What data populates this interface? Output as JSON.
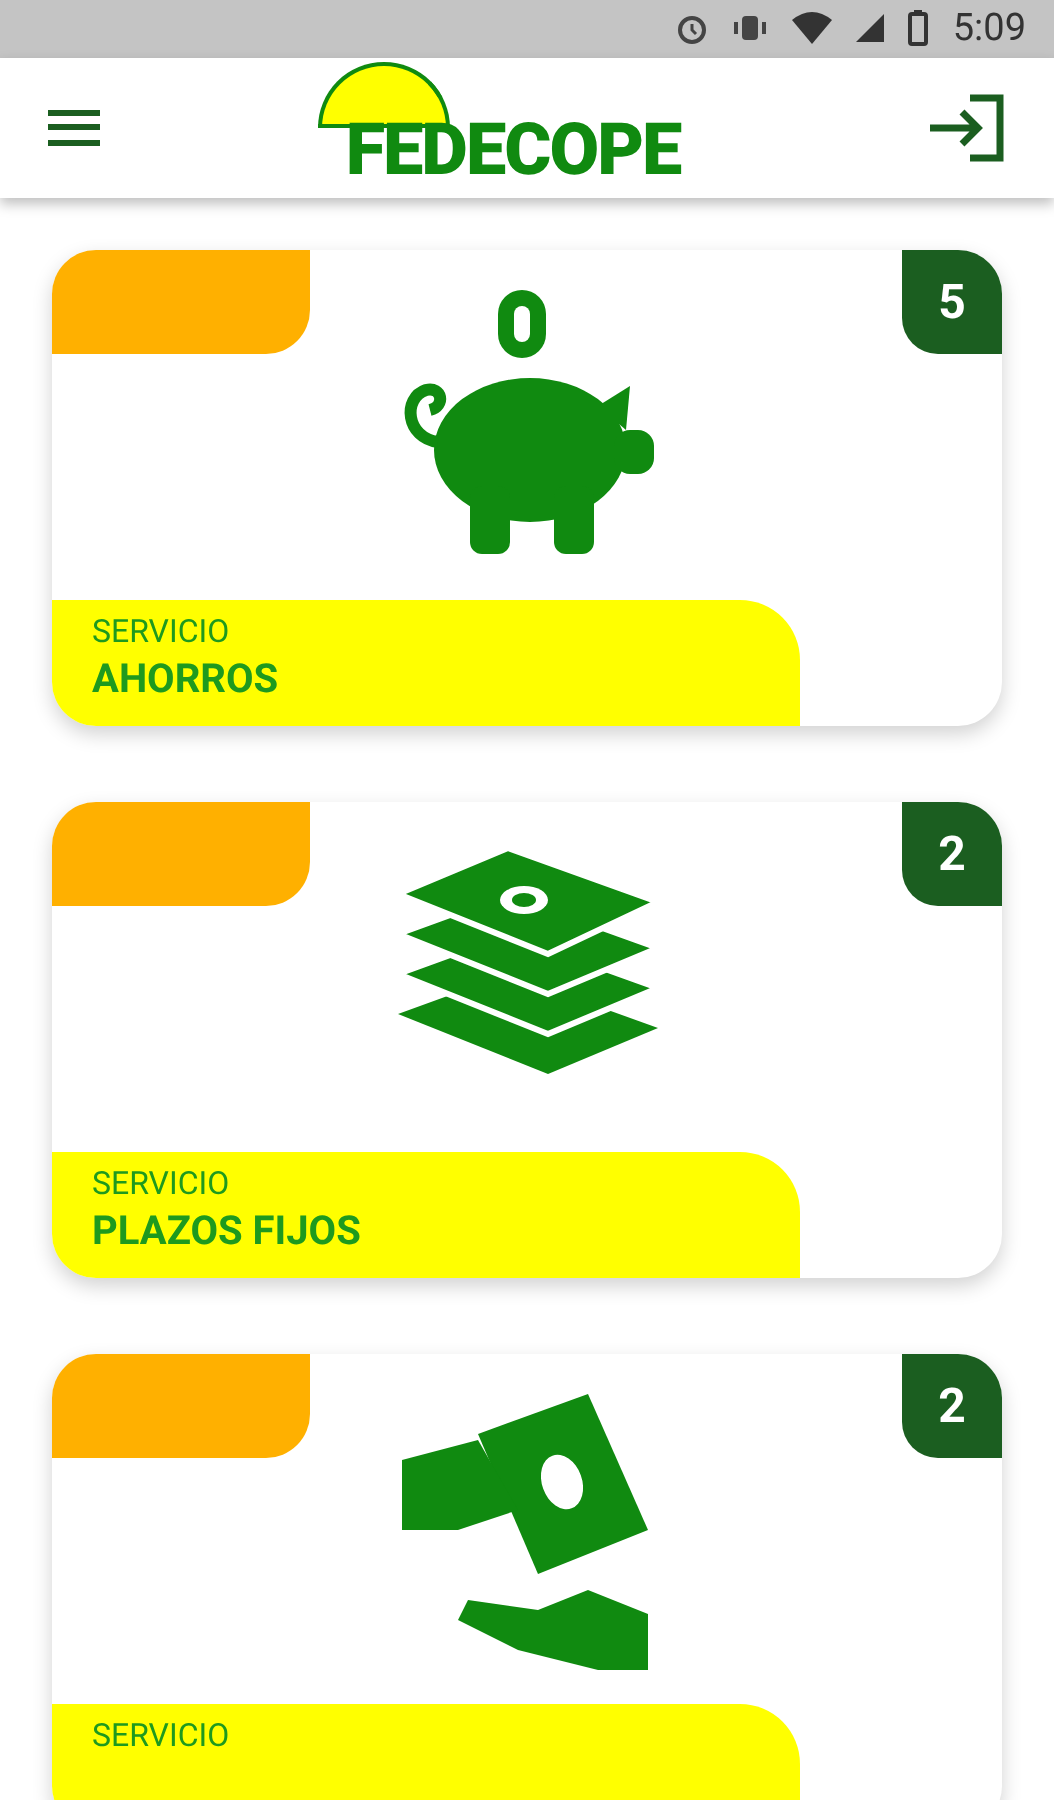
{
  "status_bar": {
    "time": "5:09"
  },
  "header": {
    "logo": "FEDECOPE"
  },
  "cards": [
    {
      "count": "5",
      "label": "SERVICIO",
      "title": "AHORROS"
    },
    {
      "count": "2",
      "label": "SERVICIO",
      "title": "PLAZOS FIJOS"
    },
    {
      "count": "2",
      "label": "SERVICIO"
    }
  ]
}
